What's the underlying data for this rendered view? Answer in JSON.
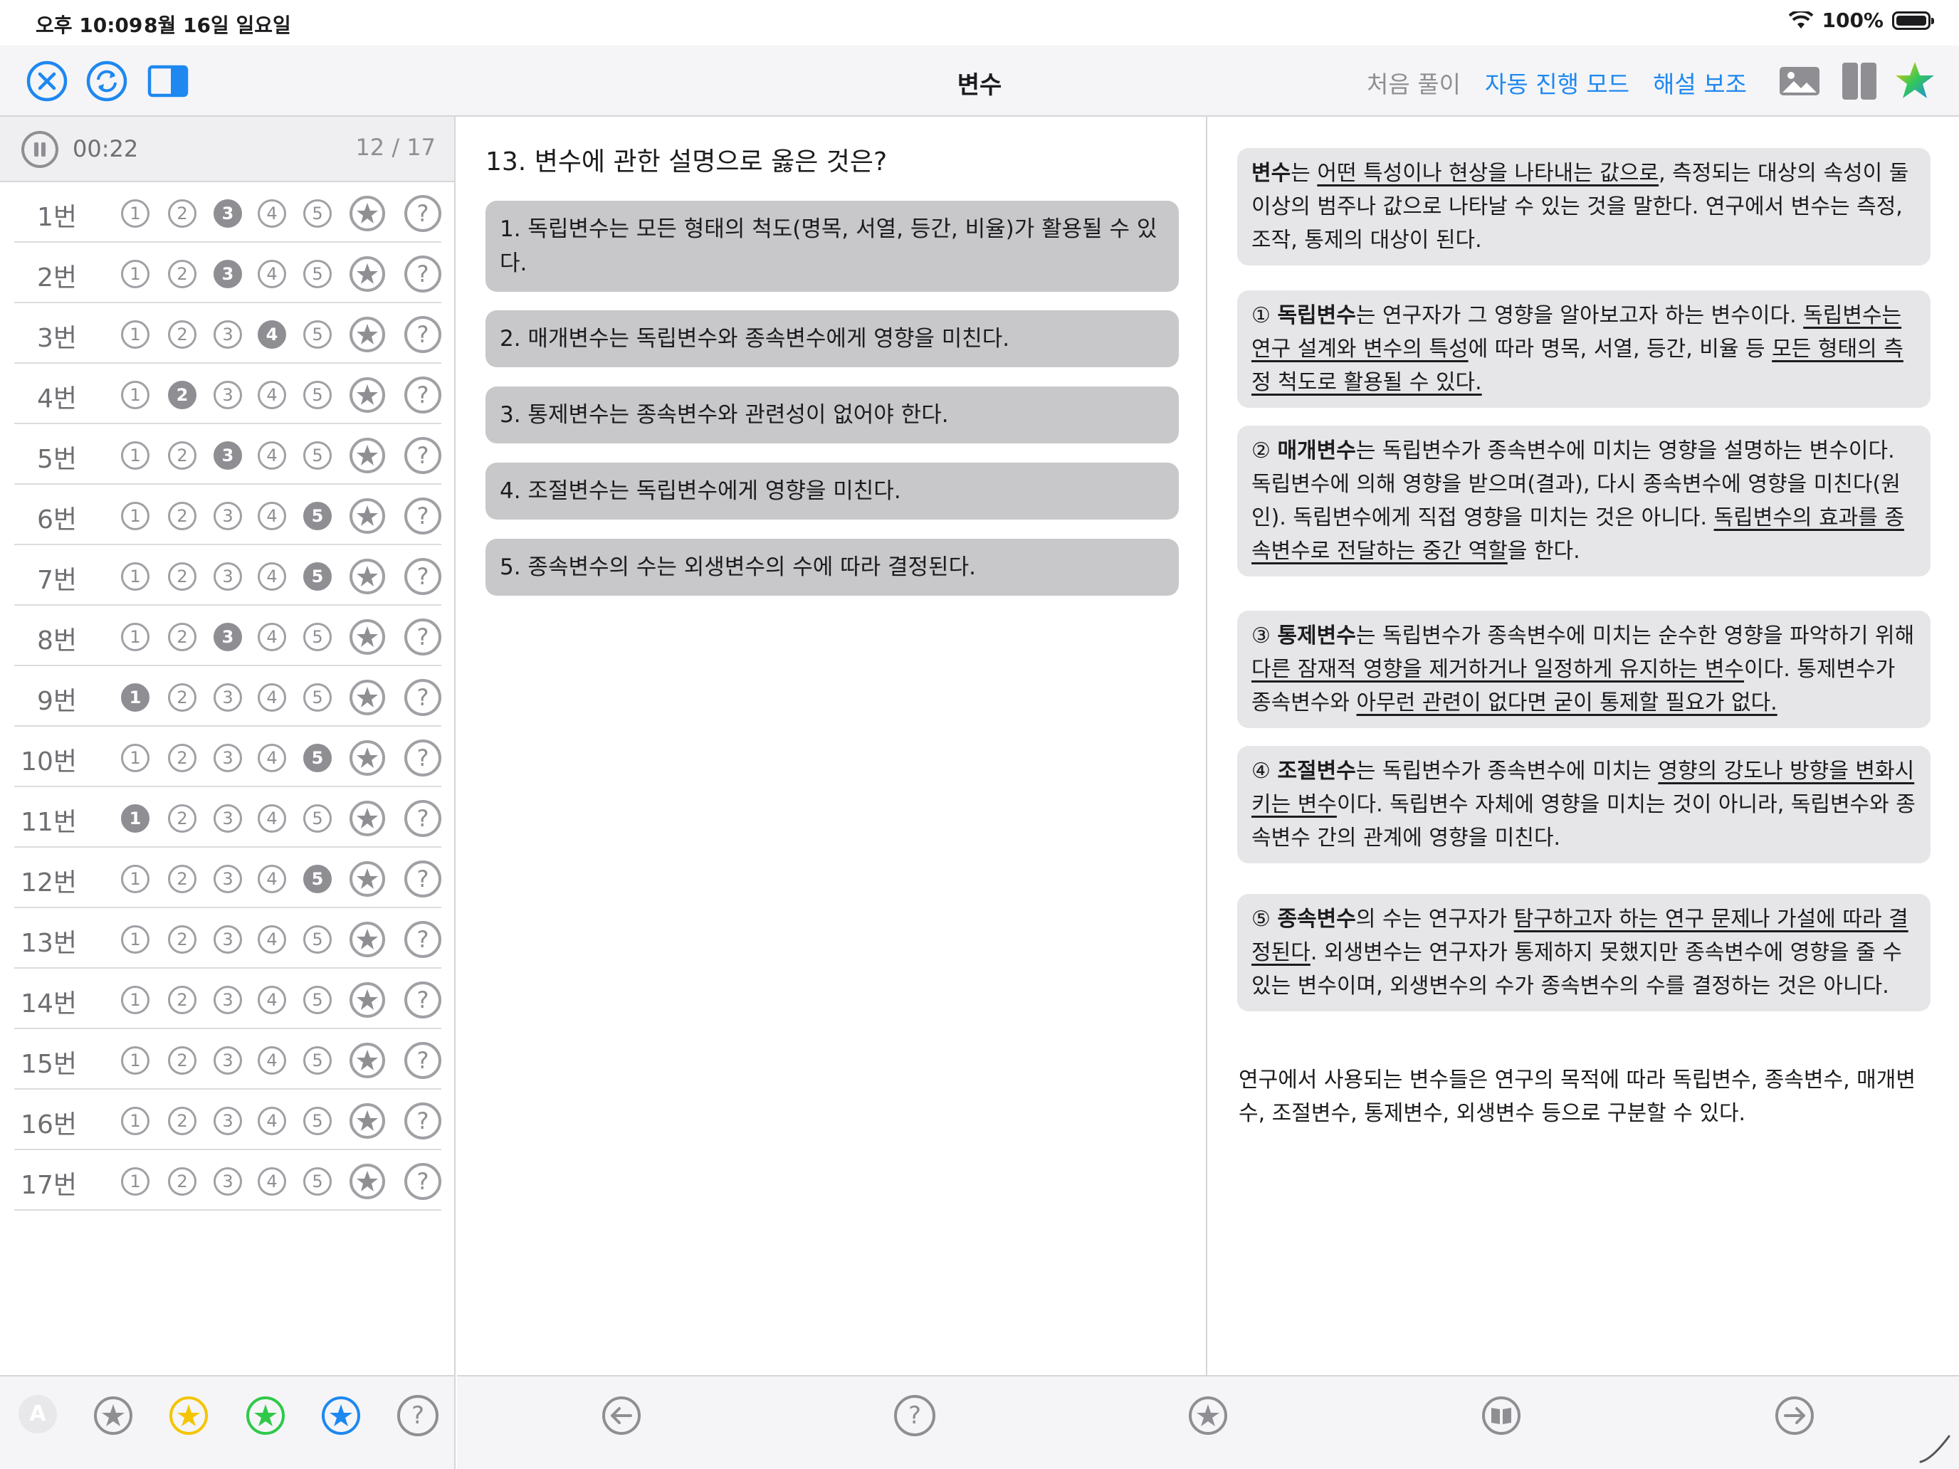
{
  "status_bar": {
    "time": "오후 10:09",
    "date": "8월 16일 일요일",
    "battery": "100%"
  },
  "toolbar": {
    "title": "변수",
    "first_solve": "처음 풀이",
    "auto_mode": "자동 진행 모드",
    "explain_assist": "해설 보조",
    "accent_color": "#1e88f0"
  },
  "timer": {
    "elapsed": "00:22",
    "progress": "12 / 17"
  },
  "answer_sheet": [
    {
      "label": "1번",
      "selected": 3
    },
    {
      "label": "2번",
      "selected": 3
    },
    {
      "label": "3번",
      "selected": 4
    },
    {
      "label": "4번",
      "selected": 2
    },
    {
      "label": "5번",
      "selected": 3
    },
    {
      "label": "6번",
      "selected": 5
    },
    {
      "label": "7번",
      "selected": 5
    },
    {
      "label": "8번",
      "selected": 3
    },
    {
      "label": "9번",
      "selected": 1
    },
    {
      "label": "10번",
      "selected": 5
    },
    {
      "label": "11번",
      "selected": 1
    },
    {
      "label": "12번",
      "selected": 5
    },
    {
      "label": "13번",
      "selected": 0
    },
    {
      "label": "14번",
      "selected": 0
    },
    {
      "label": "15번",
      "selected": 0
    },
    {
      "label": "16번",
      "selected": 0
    },
    {
      "label": "17번",
      "selected": 0
    }
  ],
  "option_numbers": [
    "1",
    "2",
    "3",
    "4",
    "5"
  ],
  "question": {
    "title": "13. 변수에 관한 설명으로 옳은 것은?",
    "choices": [
      "1. 독립변수는 모든 형태의 척도(명목, 서열, 등간, 비율)가 활용될 수 있다.",
      "2. 매개변수는 독립변수와 종속변수에게 영향을 미친다.",
      "3. 통제변수는 종속변수와 관련성이 없어야 한다.",
      "4. 조절변수는 독립변수에게 영향을 미친다.",
      "5. 종속변수의 수는 외생변수의 수에 따라 결정된다."
    ]
  },
  "explanation": {
    "intro": {
      "term": "변수",
      "p1": "는 ",
      "u1": "어떤 특성이나 현상을 나타내는 값으로",
      "p2": ", 측정되는 대상의 속성이 둘 이상의 범주나 값으로 나타날 수 있는 것을 말한다. 연구에서 변수는 측정, 조작, 통제의 대상이 된다."
    },
    "item1": {
      "num": "①",
      "term": "독립변수",
      "p1": "는 연구자가 그 영향을 알아보고자 하는 변수이다. ",
      "u1": "독립변수는 연구 설계와 변수의 특성",
      "p2": "에 따라 명목, 서열, 등간, 비율 등 ",
      "u2": "모든 형태의 측정 척도로 활용될 수 있다."
    },
    "item2": {
      "num": "②",
      "term": "매개변수",
      "p1": "는 독립변수가 종속변수에 미치는 영향을 설명하는 변수이다. 독립변수에 의해 영향을 받으며(결과), 다시 종속변수에 영향을 미친다(원인). 독립변수에게 직접 영향을 미치는 것은 아니다. ",
      "u1": "독립변수의 효과를 종속변수로 전달하는 중간 역할",
      "p2": "을 한다."
    },
    "item3": {
      "num": "③",
      "term": "통제변수",
      "p1": "는 독립변수가 종속변수에 미치는 순수한 영향을 파악하기 위해 ",
      "u1": "다른 잠재적 영향을 제거하거나 일정하게 유지하는 변수",
      "p2": "이다. 통제변수가 종속변수와 ",
      "u2": "아무런 관련이 없다면 굳이 통제할 필요가 없다."
    },
    "item4": {
      "num": "④",
      "term": "조절변수",
      "p1": "는 독립변수가 종속변수에 미치는 ",
      "u1": "영향의 강도나 방향을 변화시키는 변수",
      "p2": "이다. 독립변수 자체에 영향을 미치는 것이 아니라, 독립변수와 종속변수 간의 관계에 영향을 미친다."
    },
    "item5": {
      "num": "⑤",
      "term": "종속변수",
      "p1": "의 수는 연구자가 ",
      "u1": "탐구하고자 하는 연구 문제나 가설에 따라 결정된다",
      "p2": ". 외생변수는 연구자가 통제하지 못했지만 종속변수에 영향을 줄 수 있는 변수이며, 외생변수의 수가 종속변수의 수를 결정하는 것은 아니다."
    },
    "summary": "연구에서 사용되는 변수들은 연구의 목적에 따라 독립변수, 종속변수, 매개변수, 조절변수, 통제변수, 외생변수 등으로 구분할 수 있다."
  },
  "bottom_left": {
    "avatar_letter": "A",
    "star_colors": [
      "#8e8e93",
      "#f5c400",
      "#2fc94a",
      "#1e88f0"
    ]
  }
}
